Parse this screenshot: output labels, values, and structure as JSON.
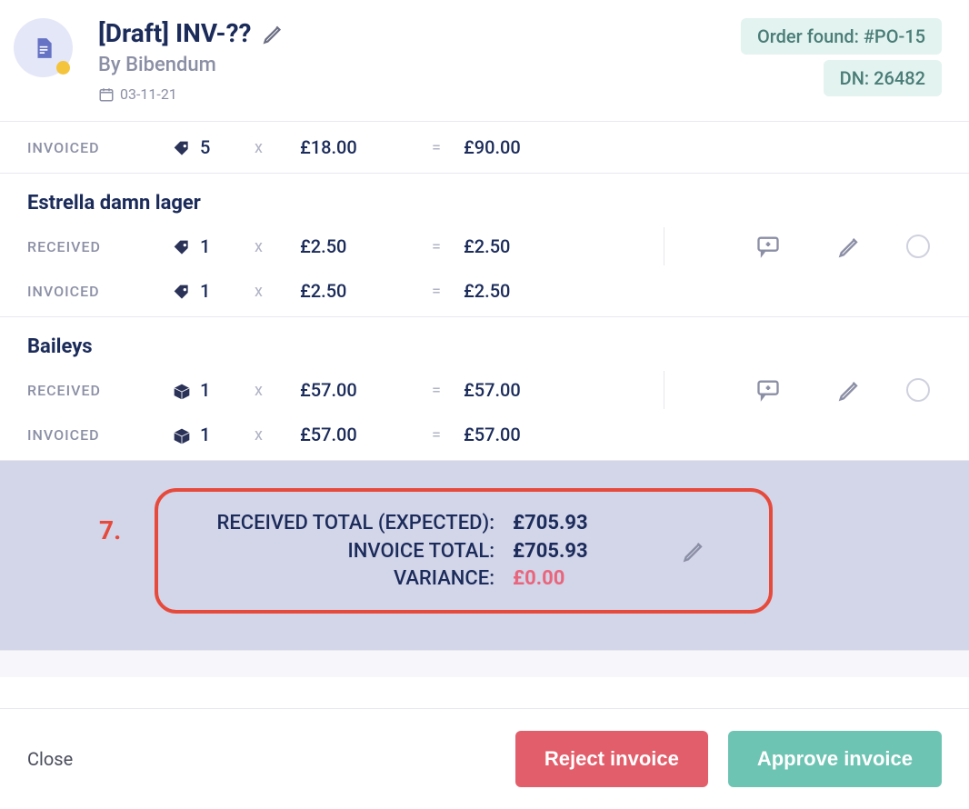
{
  "header": {
    "title": "[Draft] INV-??",
    "supplier": "By Bibendum",
    "date": "03-11-21",
    "order_found": "Order found: #PO-15",
    "dn": "DN: 26482"
  },
  "lines": {
    "orphan": {
      "invoiced_label": "INVOICED",
      "qty": "5",
      "price": "£18.00",
      "total": "£90.00"
    },
    "estrella": {
      "name": "Estrella damn lager",
      "received_label": "RECEIVED",
      "received_qty": "1",
      "received_price": "£2.50",
      "received_total": "£2.50",
      "invoiced_label": "INVOICED",
      "invoiced_qty": "1",
      "invoiced_price": "£2.50",
      "invoiced_total": "£2.50"
    },
    "baileys": {
      "name": "Baileys",
      "received_label": "RECEIVED",
      "received_qty": "1",
      "received_price": "£57.00",
      "received_total": "£57.00",
      "invoiced_label": "INVOICED",
      "invoiced_qty": "1",
      "invoiced_price": "£57.00",
      "invoiced_total": "£57.00"
    }
  },
  "symbols": {
    "times": "x",
    "equals": "="
  },
  "totals": {
    "callout_num": "7.",
    "received_label": "RECEIVED TOTAL (EXPECTED):",
    "received_value": "£705.93",
    "invoice_label": "INVOICE TOTAL:",
    "invoice_value": "£705.93",
    "variance_label": "VARIANCE:",
    "variance_value": "£0.00"
  },
  "footer": {
    "close": "Close",
    "reject": "Reject invoice",
    "approve": "Approve invoice"
  }
}
